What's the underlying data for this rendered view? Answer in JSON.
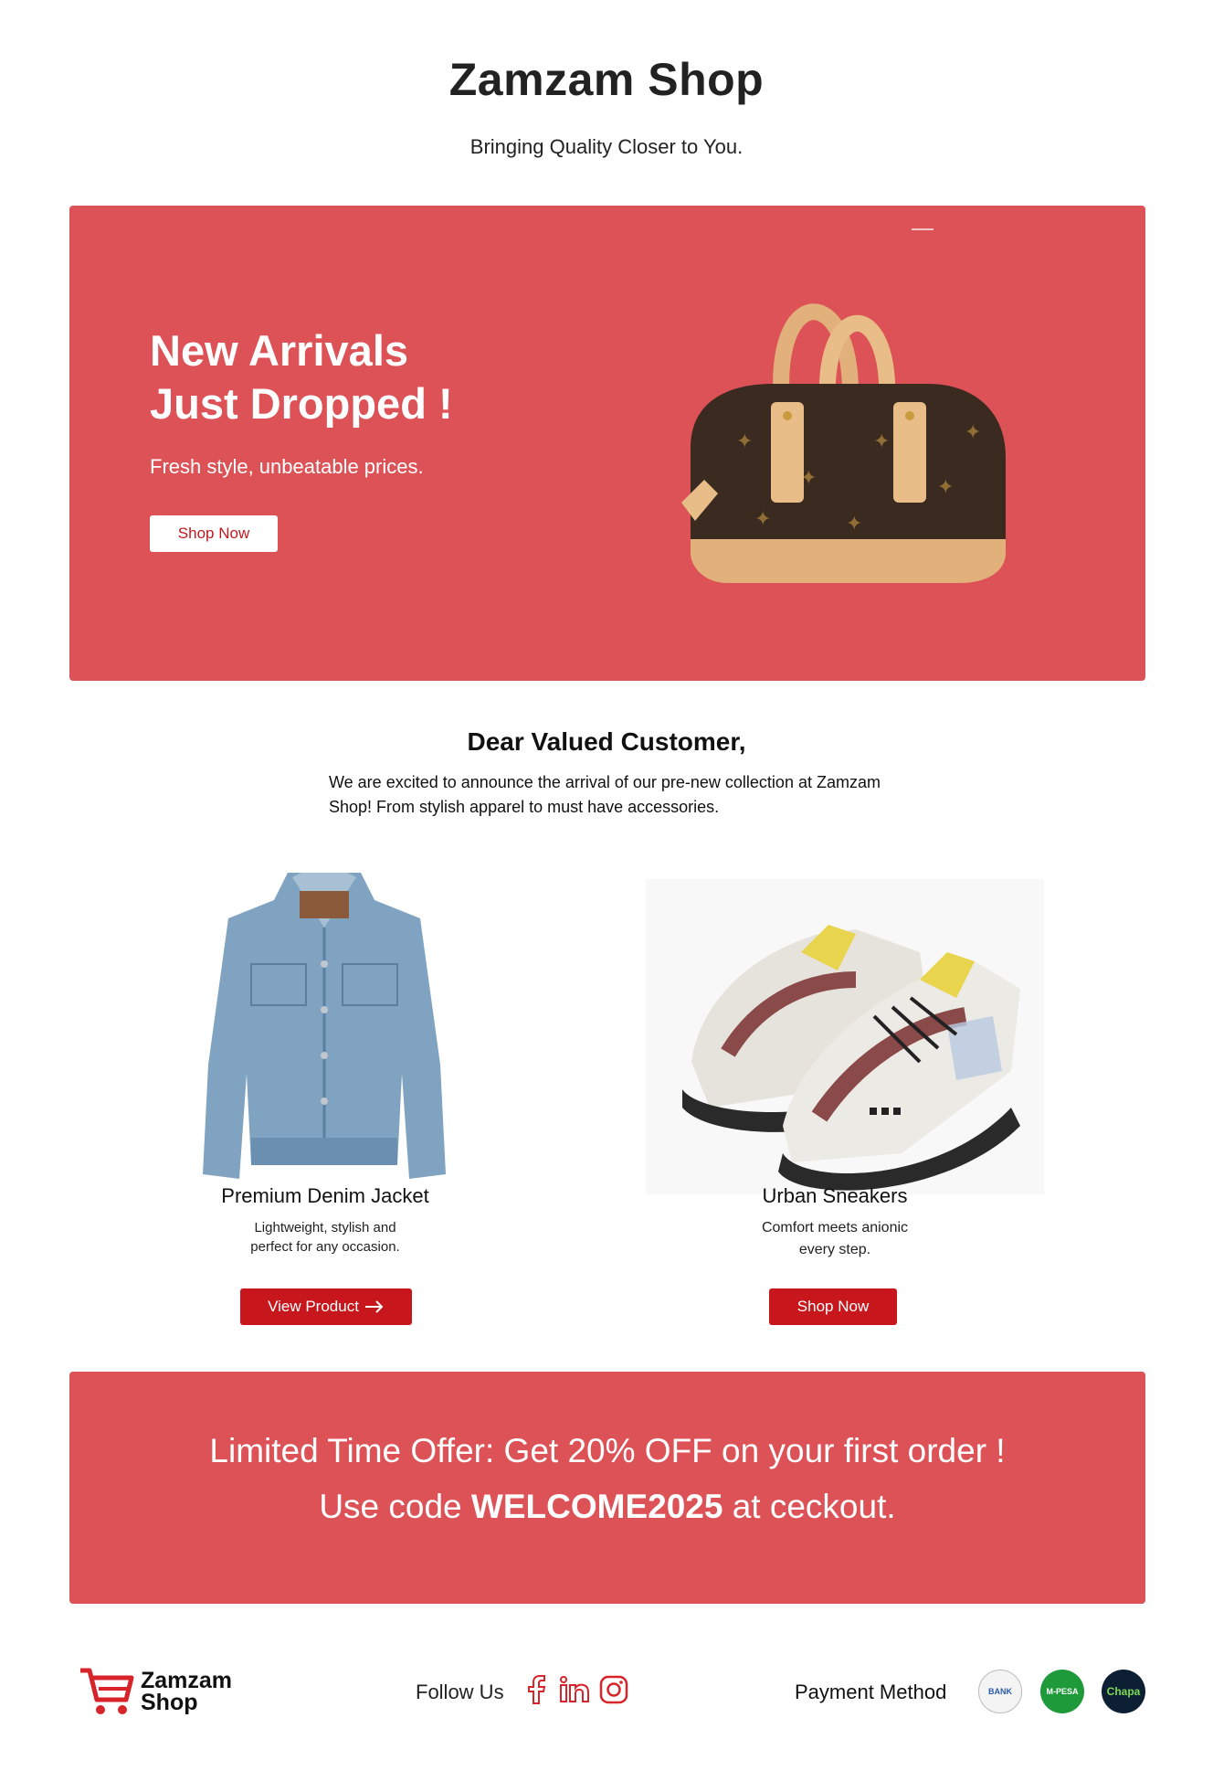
{
  "header": {
    "title": "Zamzam Shop",
    "tagline": "Bringing Quality Closer to You."
  },
  "hero": {
    "heading_line1": "New Arrivals",
    "heading_line2": "Just Dropped !",
    "subtitle": "Fresh style, unbeatable prices.",
    "button_label": "Shop Now",
    "image_icon": "handbag-image"
  },
  "intro": {
    "greeting": "Dear Valued Customer,",
    "body": "We are excited to announce the arrival of our pre-new collection at Zamzam Shop! From stylish apparel to must have accessories."
  },
  "products": [
    {
      "name": "Premium Denim Jacket",
      "desc_line1": "Lightweight, stylish and",
      "desc_line2": "perfect for any occasion.",
      "button_label": "View Product",
      "image_icon": "denim-jacket-image"
    },
    {
      "name": "Urban Sneakers",
      "desc_line1": "Comfort meets anionic",
      "desc_line2": "every step.",
      "button_label": "Shop Now",
      "image_icon": "sneakers-image"
    }
  ],
  "offer": {
    "line1": "Limited Time Offer: Get 20% OFF on your first order !",
    "line2_prefix": "Use code ",
    "code": "WELCOME2025",
    "line2_suffix": " at ceckout."
  },
  "footer": {
    "logo_line1": "Zamzam",
    "logo_line2": "Shop",
    "follow_label": "Follow Us",
    "social_icons": [
      "facebook-icon",
      "linkedin-icon",
      "instagram-icon"
    ],
    "payment_label": "Payment Method",
    "payment_badges": [
      {
        "label": "BANK"
      },
      {
        "label": "M-PESA"
      },
      {
        "label": "Chapa"
      }
    ]
  },
  "colors": {
    "banner": "#dc5256",
    "button_red": "#c8161d",
    "text_dark": "#111111"
  }
}
